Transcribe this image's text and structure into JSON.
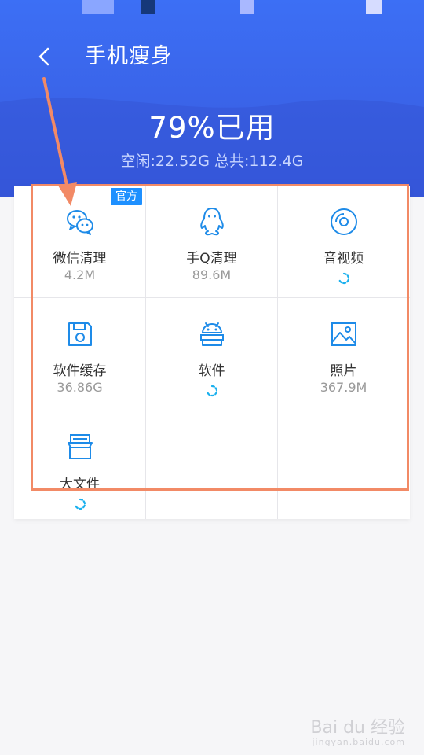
{
  "header": {
    "title": "手机瘦身",
    "usage_percent": "79%已用",
    "usage_detail": "空闲:22.52G 总共:112.4G"
  },
  "badge": {
    "label": "官方"
  },
  "tiles": [
    {
      "label": "微信清理",
      "size": "4.2M",
      "icon": "wechat-icon"
    },
    {
      "label": "手Q清理",
      "size": "89.6M",
      "icon": "qq-penguin-icon"
    },
    {
      "label": "音视频",
      "size": "",
      "icon": "disc-icon",
      "loading": true
    },
    {
      "label": "软件缓存",
      "size": "36.86G",
      "icon": "save-disk-icon"
    },
    {
      "label": "软件",
      "size": "",
      "icon": "android-icon",
      "loading": true
    },
    {
      "label": "照片",
      "size": "367.9M",
      "icon": "image-icon"
    },
    {
      "label": "大文件",
      "size": "",
      "icon": "archive-box-icon",
      "loading": true
    }
  ],
  "watermark": {
    "brand": "Bai du 经验",
    "url": "jingyan.baidu.com"
  },
  "colors": {
    "header_blue": "#3a63e8",
    "accent": "#1e90ff",
    "highlight": "#f28a66"
  }
}
